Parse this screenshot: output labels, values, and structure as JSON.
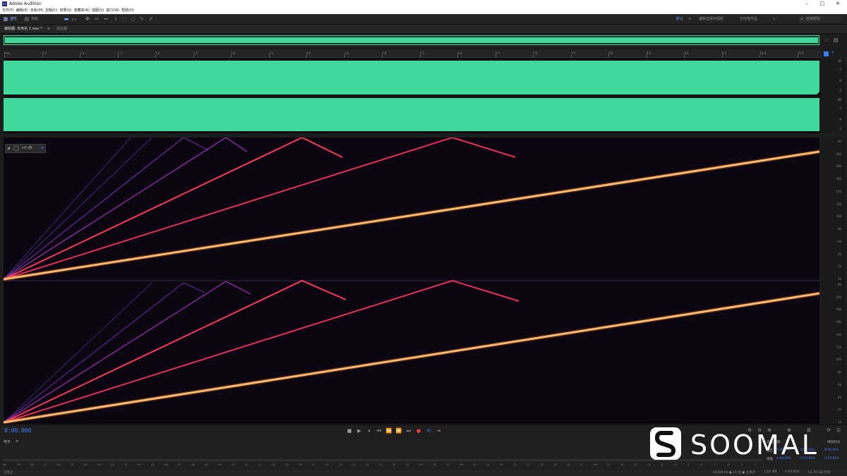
{
  "window": {
    "title": "Adobe Audition",
    "app_icon_label": "Au"
  },
  "menu": [
    "文件(F)",
    "编辑(E)",
    "多轨(M)",
    "剪辑(C)",
    "效果(S)",
    "收藏夹(R)",
    "视图(V)",
    "窗口(W)",
    "帮助(H)"
  ],
  "toolbar": {
    "waveform_label": "波形",
    "multitrack_label": "多轨",
    "workspaces": [
      "默认",
      "编辑音频到视频",
      "无线电作品"
    ],
    "search_placeholder": "搜索帮助"
  },
  "tabs": [
    {
      "label": "编辑器: 未命名 1.wav *"
    },
    {
      "label": "混合器"
    }
  ],
  "ruler": {
    "labels": [
      "hms",
      "0.5",
      "1.0",
      "1.5",
      "2.0",
      "2.5",
      "3.0",
      "3.5",
      "4.0",
      "4.5",
      "5.0",
      "5.5",
      "6.0",
      "6.5",
      "7.0",
      "7.5",
      "8.0",
      "8.5",
      "9.0",
      "9.5",
      "10.0",
      "10.5"
    ]
  },
  "waveform_db_labels": [
    "dB",
    "-3",
    "-9",
    "-3"
  ],
  "spectral_hz_labels": [
    "Hz",
    "20k",
    "18k",
    "16k",
    "14k",
    "12k",
    "10k",
    "8k",
    "6k",
    "4k",
    "2k",
    "1k"
  ],
  "hud": {
    "gain": "+0 dB"
  },
  "transport": {
    "timecode": "0:00.000"
  },
  "levels": {
    "title": "电平",
    "scale": [
      "dB",
      "-59",
      "-58",
      "-57",
      "-56",
      "-55",
      "-54",
      "-53",
      "-52",
      "-51",
      "-50",
      "-49",
      "-48",
      "-47",
      "-46",
      "-45",
      "-44",
      "-43",
      "-42",
      "-41",
      "-40",
      "-39",
      "-38",
      "-37",
      "-36",
      "-35",
      "-34",
      "-33",
      "-32",
      "-31",
      "-30",
      "-29",
      "-28",
      "-27",
      "-26",
      "-25",
      "-24",
      "-23",
      "-22",
      "-21",
      "-20",
      "-19",
      "-18",
      "-17",
      "-16",
      "-15",
      "-14",
      "-13",
      "-12",
      "-11",
      "-10",
      "-9",
      "-8",
      "-7",
      "-6",
      "-5",
      "-4",
      "-3",
      "-2",
      "-1",
      "0"
    ]
  },
  "selection": {
    "title": "选区/视图",
    "col_duration": "持续时间",
    "row_selection": "选区",
    "row_view": "视图",
    "sel_start": "0:00.000",
    "sel_end": "0:00.000",
    "sel_dur": "0:00.000",
    "view_start": "0:00.000",
    "view_end": "0:10.819",
    "view_dur": "0:10.819"
  },
  "status": {
    "left": "已停止",
    "format": "44100 Hz ● 16 位 ● 立体声",
    "size": "1.82 MB",
    "duration": "0:10.819",
    "disk": "52.76 GB 空闲"
  },
  "watermark": {
    "text": "SOOMAL"
  },
  "spectrum_colors": {
    "fundamental": "#ffd27a",
    "harmonic": "#ff3a5c",
    "faint": "#7d3aa8"
  }
}
